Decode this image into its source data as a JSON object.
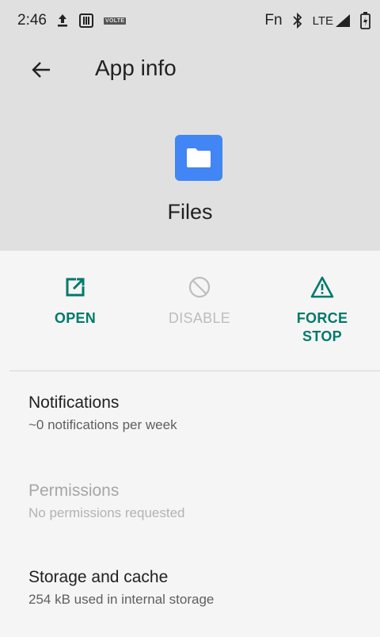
{
  "status_bar": {
    "time": "2:46",
    "volte": "VOLTE",
    "fn": "Fn",
    "lte": "LTE"
  },
  "toolbar": {
    "title": "App info"
  },
  "app": {
    "name": "Files",
    "icon": "folder-icon",
    "icon_color": "#4285f4"
  },
  "actions": {
    "open": "OPEN",
    "disable": "DISABLE",
    "force_stop": "FORCE\nSTOP",
    "accent_color": "#00796b",
    "disabled_color": "#bdbdbd"
  },
  "settings": [
    {
      "title": "Notifications",
      "subtitle": "~0 notifications per week",
      "enabled": true
    },
    {
      "title": "Permissions",
      "subtitle": "No permissions requested",
      "enabled": false
    },
    {
      "title": "Storage and cache",
      "subtitle": "254 kB used in internal storage",
      "enabled": true
    }
  ]
}
